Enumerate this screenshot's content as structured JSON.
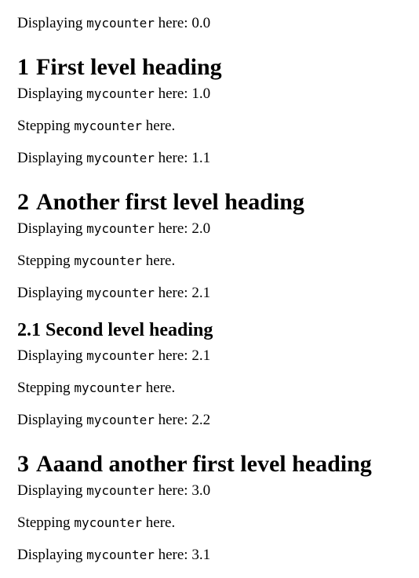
{
  "blocks": [
    {
      "type": "display",
      "prefix": "Displaying",
      "code": "mycounter",
      "suffix": "here:",
      "value": "0.0"
    },
    {
      "type": "heading1",
      "number": "1",
      "title": "First level heading"
    },
    {
      "type": "display",
      "prefix": "Displaying",
      "code": "mycounter",
      "suffix": "here:",
      "value": "1.0"
    },
    {
      "type": "step",
      "prefix": "Stepping",
      "code": "mycounter",
      "suffix": "here."
    },
    {
      "type": "display",
      "prefix": "Displaying",
      "code": "mycounter",
      "suffix": "here:",
      "value": "1.1"
    },
    {
      "type": "heading1",
      "number": "2",
      "title": "Another first level heading"
    },
    {
      "type": "display",
      "prefix": "Displaying",
      "code": "mycounter",
      "suffix": "here:",
      "value": "2.0"
    },
    {
      "type": "step",
      "prefix": "Stepping",
      "code": "mycounter",
      "suffix": "here."
    },
    {
      "type": "display",
      "prefix": "Displaying",
      "code": "mycounter",
      "suffix": "here:",
      "value": "2.1"
    },
    {
      "type": "heading2",
      "number": "2.1",
      "title": "Second level heading"
    },
    {
      "type": "display",
      "prefix": "Displaying",
      "code": "mycounter",
      "suffix": "here:",
      "value": "2.1"
    },
    {
      "type": "step",
      "prefix": "Stepping",
      "code": "mycounter",
      "suffix": "here."
    },
    {
      "type": "display",
      "prefix": "Displaying",
      "code": "mycounter",
      "suffix": "here:",
      "value": "2.2"
    },
    {
      "type": "heading1",
      "number": "3",
      "title": "Aaand another first level heading"
    },
    {
      "type": "display",
      "prefix": "Displaying",
      "code": "mycounter",
      "suffix": "here:",
      "value": "3.0"
    },
    {
      "type": "step",
      "prefix": "Stepping",
      "code": "mycounter",
      "suffix": "here."
    },
    {
      "type": "display",
      "prefix": "Displaying",
      "code": "mycounter",
      "suffix": "here:",
      "value": "3.1"
    }
  ]
}
